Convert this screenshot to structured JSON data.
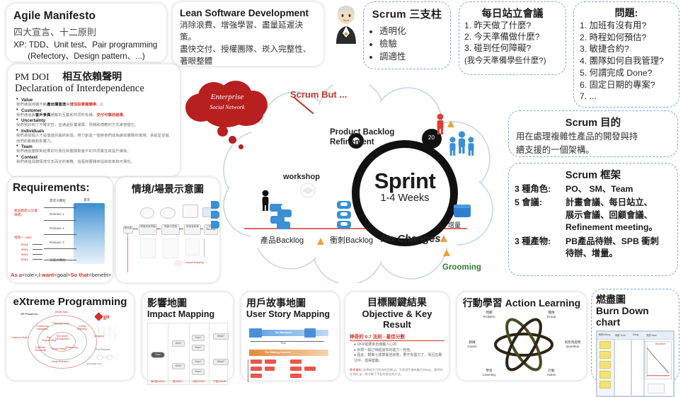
{
  "agile": {
    "title": "Agile Manifesto",
    "subtitle": "四大宣言、十二原則",
    "line1": "XP: TDD、Unit test、Pair programming",
    "line2": "(Refectory、Design pattern、...)"
  },
  "lean": {
    "title": "Lean Software Development",
    "line1": "消除浪費、增強學習、盡量延遲決",
    "line2": "策。",
    "line3": "盡快交付、授權團隊、崁入完整性、",
    "line4": "著眼整體"
  },
  "pillars": {
    "title": "Scrum 三支柱",
    "items": [
      "透明化",
      "檢驗",
      "調適性"
    ]
  },
  "daily": {
    "title": "每日站立會議",
    "items": [
      "1. 昨天做了什麼?",
      "2. 今天準備做什麼?",
      "3. 碰到任何障礙?"
    ],
    "note": "(我今天準備學些什麼?)"
  },
  "issues": {
    "title": "問題:",
    "items": [
      "1. 加班有沒有用?",
      "2. 時程如何預估?",
      "3. 敏捷合約?",
      "4. 團隊如何自我管理?",
      "5. 何謂完成 Done?",
      "6. 固定日期的專案?",
      "7. ..."
    ]
  },
  "doi": {
    "label": "PM DOI",
    "title_zh": "相互依賴聲明",
    "title_en": "Declaration of Interdependence",
    "bullets": [
      {
        "term": "Value",
        "desc": "我們通過持續不斷<b>產出價值流</b>來<r>增加投資報酬率</r>。()"
      },
      {
        "term": "Customer",
        "desc": "我們通過與<b>客戶參與</b>頻繁的互動和共同所有權，<r>交付可靠的結果</r>。"
      },
      {
        "term": "Uncertainty",
        "desc": "我們預料到了不確定性，並通過反覆運算、預期和適應的方式來管理它。"
      },
      {
        "term": "Individuals",
        "desc": "我們承認個人才是價值的最終來源，努力創造一個使他們成為績效團隊的環境，承認並促進他們的動機和影響力。"
      },
      {
        "term": "Team",
        "desc": "我們通過團隊對結果的可責任和團隊對客戶的共同責任來提升績效。"
      },
      {
        "term": "Context",
        "desc": "我們通過具體情境交叉而定的策略、過程和實踐來提高效率和可靠性。"
      }
    ]
  },
  "requirements": {
    "title": "Requirements:",
    "top_label": "需求大顆粒",
    "bottom_label": "功能大顆粒",
    "right_label": "需求",
    "releases": [
      "Release 1",
      "Release 2",
      "Release 3"
    ],
    "red_left_top": "產品願景\\n(企業目標)",
    "red_left_mid": "用例 — epic",
    "story_items": [
      "story",
      "story",
      "story",
      "story"
    ],
    "caption_red1": "As a",
    "caption_black1": "<role>",
    "caption_red2": ",I want",
    "caption_black2": "<goal>",
    "caption_red3": "So that",
    "caption_black3": "<benefit>"
  },
  "scenario": {
    "title": "情境/場景示意圖",
    "nodes": [
      "使用者",
      "情境探索會議",
      "場景示意圖",
      "使用者故事",
      "工作項目 Backlog"
    ],
    "tail": "Impact Mapping"
  },
  "cloud": {
    "sprint_title": "Sprint",
    "sprint_sub": "1-4 Weeks",
    "product_backlog_refinement": "Product Backlog\nRefinement",
    "pbr_line1": "Product Backlog",
    "pbr_line2": "Refinement",
    "workshop": "workshop",
    "product_backlog": "產品Backlog",
    "sprint_backlog": "衝刺Backlog",
    "increment": "增量",
    "no_changes": "No Changes",
    "scrum_but": "Scrum But ...",
    "grooming": "Grooming",
    "enterprise_line1": "Enterprise",
    "enterprise_line2": "Social Network",
    "sprint_number": "20"
  },
  "purpose": {
    "title": "Scrum 目的",
    "line1": "用在處理複雜性產品的開發與持",
    "line2": "續支援的一個架構。"
  },
  "framework": {
    "title": "Scrum 框架",
    "rows": [
      {
        "key": "3 種角色:",
        "value": "PO、 SM、Team",
        "cont": []
      },
      {
        "key": "5 會議:",
        "value": "計畫會議、每日站立、",
        "cont": [
          "展示會議、回顧會議、",
          "Refinement meeting。"
        ]
      },
      {
        "key": "3 種產物:",
        "value": "PB產品待辦、SPB 衝刺",
        "cont": [
          "待辦、增量。"
        ]
      }
    ]
  },
  "xp": {
    "title": "eXtreme Programming",
    "fig_title": "XP Practices",
    "git_label": "git",
    "pull_request": "Pull Request",
    "practices": [
      "Whole Team",
      "Continuous Integration",
      "Coding Standard",
      "Customer Tests",
      "Planning Game",
      "Pair Programming",
      "Test-Driven Development",
      "Refactoring",
      "Simple Design",
      "Small Releases",
      "Collective Ownership",
      "Metaphor",
      "Sustainable Pace"
    ]
  },
  "impact_mapping": {
    "title_zh": "影響地圖",
    "title_en": "Impact Mapping",
    "nodes": [
      "Goal",
      "Who?",
      "How?",
      "What?"
    ],
    "columns": [
      "為什麼\\nWhy?",
      "誰\\nWho?",
      "如何\\nHow?",
      "什麼\\nWhat?"
    ]
  },
  "user_story_mapping": {
    "title_zh": "用戶故事地圖",
    "title_en": "User Story Mapping",
    "backbone": "The Backbone",
    "walking_skeleton": "The Walking Skeleton",
    "time_label": "Time"
  },
  "okr": {
    "title_zh": "目標關鍵結果",
    "title_en": "Objective & Key Result",
    "subhead": "神奇的 0.7 法則 - 最佳分數",
    "bullets": [
      "OKR需要來自激勵人心的",
      "目標一般訂得超過你的能力一些些。",
      "因此，鞭策七成算最佳狀態，要不你盡力了，而且在專注中，值得獎勵。"
    ],
    "footnote_label": "參考資料:",
    "footnote": "如果給予可完成的目標 gt，大家就不會有動力的way。那時你在你的 gt，那才算了不起的設定的方法。"
  },
  "action_learning": {
    "title": "行動學習 Action Learning",
    "labels": [
      {
        "zh": "問題",
        "en": "Problem"
      },
      {
        "zh": "團隊",
        "en": "Group"
      },
      {
        "zh": "教練",
        "en": "Coach"
      },
      {
        "zh": "洞見和提問",
        "en": "Question"
      },
      {
        "zh": "學習",
        "en": "Learning"
      },
      {
        "zh": "行動",
        "en": "Action"
      }
    ]
  },
  "burndown": {
    "title_zh": "燃盡圖",
    "title_en": "Burn Down chart",
    "columns": [
      "故事\\nStory",
      "待辦 To do",
      "Doing",
      "完成 Done"
    ],
    "chart_label": "Burndown"
  },
  "colors": {
    "red_cloud": "#b81f1f",
    "scrum_but": "#c0392b",
    "grooming": "#2e7d32",
    "dashed_border": "#7aa7dd",
    "blue_person": "#3b8fd4",
    "red_person": "#e03c31",
    "orange_tri": "#e8a33d"
  }
}
